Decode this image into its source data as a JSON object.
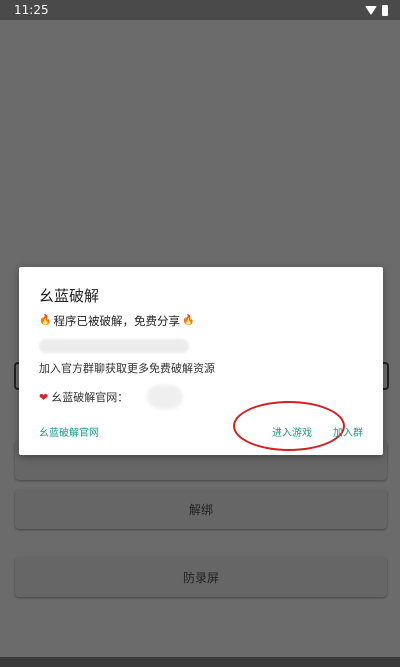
{
  "status_bar": {
    "time": "11:25"
  },
  "dialog": {
    "title": "幺蓝破解",
    "subtitle_text": "程序已被破解，免费分享",
    "description": "加入官方群聊获取更多免费破解资源",
    "site_label": "幺蓝破解官网：",
    "buttons": {
      "site": "幺蓝破解官网",
      "enter": "进入游戏",
      "join": "加入群"
    }
  },
  "background": {
    "button_unbind": "解绑",
    "button_anti_record": "防录屏"
  },
  "colors": {
    "accent": "#1a9c8c",
    "highlight_ring": "#d32020",
    "overlay": "#6b6b6b"
  }
}
